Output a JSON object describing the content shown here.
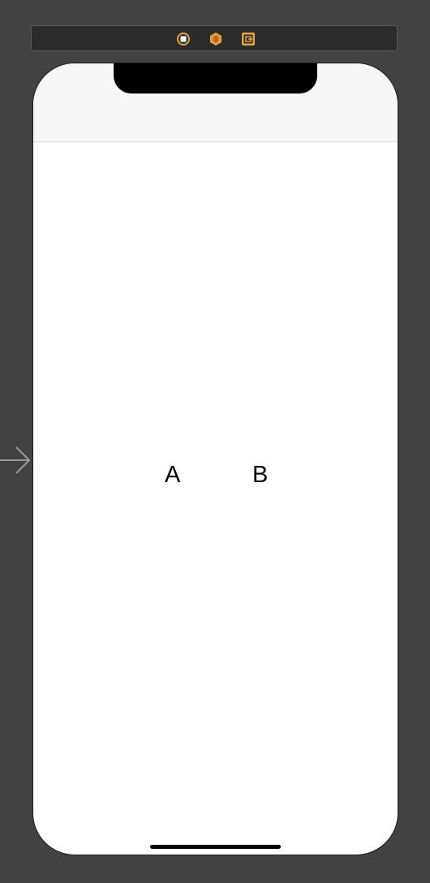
{
  "scene_dock": {
    "icons": [
      "view-controller-icon",
      "first-responder-icon",
      "exit-icon"
    ],
    "icon_color": "#e8a33d"
  },
  "entry_point": {
    "icon": "arrow-right-icon"
  },
  "view": {
    "label_a": "A",
    "label_b": "B"
  },
  "colors": {
    "canvas": "#424242",
    "device_bg": "#ffffff",
    "nav_bar_bg": "#f7f7f7"
  }
}
